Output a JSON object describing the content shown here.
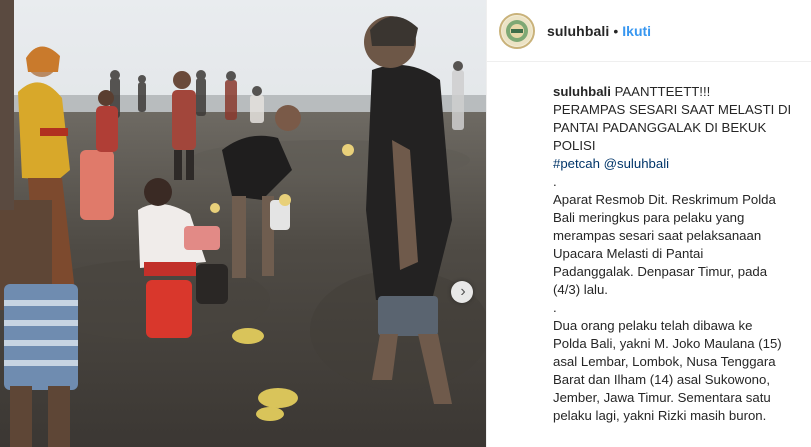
{
  "post": {
    "username": "suluhbali",
    "separator": "•",
    "follow_label": "Ikuti",
    "avatar_icon": "suluhbali-logo-icon"
  },
  "media": {
    "next_icon": "chevron-right-icon",
    "next_glyph": "›"
  },
  "caption": {
    "username": "suluhbali",
    "title_first": "PAANTTEETT!!!",
    "title_lines": [
      "PERAMPAS SESARI SAAT MELASTI DI",
      "PANTAI PADANGGALAK DI BEKUK",
      "POLISI"
    ],
    "hashtag": "#petcah",
    "mention": "@suluhbali",
    "dot1": ".",
    "para1_lines": [
      "Aparat Resmob Dit. Reskrimum Polda",
      "Bali meringkus para pelaku yang",
      "merampas sesari saat pelaksanaan",
      "Upacara Melasti di Pantai",
      "Padanggalak. Denpasar Timur, pada",
      "(4/3) lalu."
    ],
    "dot2": ".",
    "para2_lines": [
      "Dua orang pelaku telah dibawa ke",
      "Polda Bali, yakni M. Joko Maulana (15)",
      "asal Lembar, Lombok, Nusa Tenggara",
      "Barat dan Ilham (14) asal Sukowono,",
      "Jember, Jawa Timur. Sementara satu",
      "pelaku lagi, yakni Rizki masih buron."
    ]
  },
  "colors": {
    "link": "#3897f0",
    "hashtag": "#003569",
    "text": "#262626",
    "border": "#efefef"
  }
}
